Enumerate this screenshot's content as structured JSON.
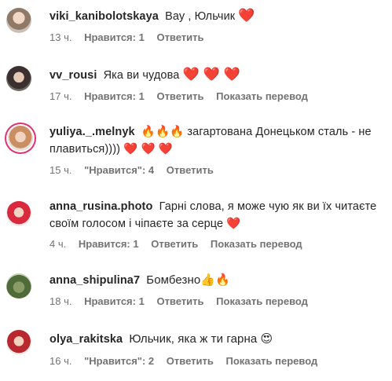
{
  "comments": [
    {
      "username": "viki_kanibolotskaya",
      "text": "Вау , Юльчик",
      "emoji": "❤️",
      "time": "13 ч.",
      "likes": "Нравится: 1",
      "reply": "Ответить",
      "translate": ""
    },
    {
      "username": "vv_rousi",
      "text": "Яка ви чудова",
      "emoji": "❤️ ❤️ ❤️",
      "time": "17 ч.",
      "likes": "Нравится: 1",
      "reply": "Ответить",
      "translate": "Показать перевод"
    },
    {
      "username": "yuliya._.melnyk",
      "text_line1": "🔥🔥🔥 загартована Донецьком сталь - не",
      "text_line2": "плавиться)))) ❤️ ❤️ ❤️",
      "time": "15 ч.",
      "likes": "\"Нравится\": 4",
      "reply": "Ответить",
      "translate": ""
    },
    {
      "username": "anna_rusina.photo",
      "text_line1": "Гарні слова, я може чую як ви їх читаєте",
      "text_line2": "своїм голосом і чіпаєте за серце ❤️",
      "time": "4 ч.",
      "likes": "Нравится: 1",
      "reply": "Ответить",
      "translate": "Показать перевод"
    },
    {
      "username": "anna_shipulina7",
      "text": "Бомбезно👍🔥",
      "time": "18 ч.",
      "likes": "Нравится: 1",
      "reply": "Ответить",
      "translate": "Показать перевод"
    },
    {
      "username": "olya_rakitska",
      "text": "Юльчик, яка ж ти гарна 😍",
      "time": "16 ч.",
      "likes": "\"Нравится\": 2",
      "reply": "Ответить",
      "translate": "Показать перевод"
    }
  ],
  "colors": {
    "heart": "#ed1c45",
    "meta": "#737373",
    "story_ring": "#e1306c"
  }
}
